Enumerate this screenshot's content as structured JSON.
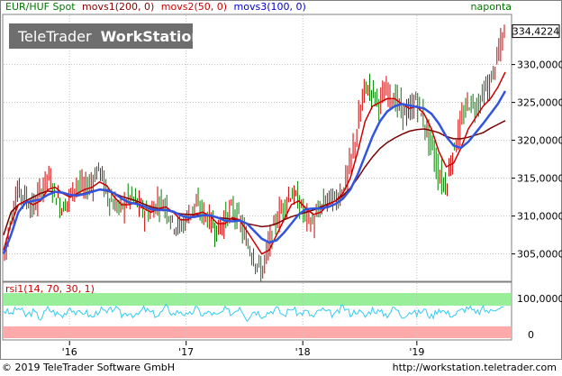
{
  "header": {
    "symbol": "EUR/HUF Spot",
    "indicators": [
      {
        "label": "movs1(200, 0)",
        "color": "#8b0000"
      },
      {
        "label": "movs2(50, 0)",
        "color": "#cc0000"
      },
      {
        "label": "movs3(100, 0)",
        "color": "#0000cc"
      }
    ],
    "source": "naponta"
  },
  "watermark": {
    "brand": "TeleTrader",
    "product": "WorkStation"
  },
  "price_axis": {
    "ticks": [
      "330,0000",
      "325,0000",
      "320,0000",
      "315,0000",
      "310,0000",
      "305,0000"
    ],
    "last_value": "334,4224"
  },
  "rsi_pane": {
    "label": "rsi1(14, 70, 30, 1)",
    "ticks": [
      "100,0000",
      "0"
    ]
  },
  "time_axis": {
    "ticks": [
      "'16",
      "'17",
      "'18",
      "'19"
    ]
  },
  "footer": {
    "copyright": "© 2019 TeleTrader Software GmbH",
    "url": "http://workstation.teletrader.com"
  },
  "colors": {
    "grid": "#bfbfbf",
    "price_up": "#cc0000",
    "price_down": "#008000",
    "ma200": "#7a0000",
    "ma50": "#cc0000",
    "ma100": "#3355dd",
    "rsi_line": "#33ccee",
    "rsi_overbought": "#99ee99",
    "rsi_oversold": "#ffaaaa"
  },
  "chart_data": {
    "type": "line",
    "title": "EUR/HUF Spot",
    "ylim": [
      301.5,
      336.5
    ],
    "yticks": [
      305,
      310,
      315,
      320,
      325,
      330
    ],
    "xticks": [
      "'16",
      "'17",
      "'18",
      "'19"
    ],
    "series": [
      {
        "name": "EUR/HUF Spot",
        "kind": "price",
        "values": [
          304.5,
          309.5,
          313.5,
          312.5,
          311.0,
          313.0,
          315.5,
          313.0,
          311.0,
          312.5,
          314.5,
          313.5,
          314.5,
          316.5,
          313.0,
          311.5,
          311.0,
          312.5,
          312.0,
          310.5,
          310.5,
          312.0,
          311.5,
          309.0,
          308.5,
          310.0,
          311.5,
          310.5,
          309.5,
          308.0,
          309.5,
          311.0,
          309.5,
          306.5,
          304.5,
          302.5,
          306.0,
          309.5,
          311.5,
          313.0,
          312.0,
          310.0,
          309.0,
          311.0,
          312.5,
          312.0,
          313.5,
          316.5,
          321.5,
          327.0,
          326.5,
          325.0,
          326.5,
          325.5,
          324.0,
          323.5,
          325.5,
          322.5,
          319.5,
          315.5,
          314.0,
          318.5,
          322.0,
          325.0,
          324.5,
          326.0,
          327.5,
          331.0,
          334.4
        ]
      },
      {
        "name": "movs1(200, 0)",
        "kind": "ma200",
        "values": [
          307.5,
          310.5,
          311.5,
          312.0,
          312.5,
          313.0,
          313.3,
          313.2,
          313.0,
          312.8,
          312.8,
          313.0,
          313.3,
          313.5,
          313.3,
          313.0,
          312.6,
          312.3,
          312.0,
          311.6,
          311.2,
          311.0,
          310.8,
          310.5,
          310.3,
          310.2,
          310.2,
          310.1,
          310.0,
          309.8,
          309.7,
          309.6,
          309.4,
          309.0,
          308.8,
          308.6,
          308.7,
          309.0,
          309.5,
          309.9,
          310.2,
          310.5,
          310.8,
          311.2,
          311.6,
          312.0,
          312.7,
          313.7,
          315.0,
          316.5,
          317.8,
          318.9,
          319.7,
          320.3,
          320.8,
          321.2,
          321.4,
          321.5,
          321.3,
          321.0,
          320.5,
          320.2,
          320.2,
          320.4,
          320.7,
          321.0,
          321.6,
          322.1,
          322.6
        ]
      },
      {
        "name": "movs2(50, 0)",
        "kind": "ma50",
        "values": [
          305.5,
          309.0,
          311.5,
          312.0,
          311.5,
          312.0,
          313.5,
          313.8,
          313.0,
          312.5,
          313.0,
          313.5,
          313.8,
          314.5,
          314.0,
          312.5,
          311.5,
          311.5,
          311.8,
          311.0,
          310.5,
          311.0,
          311.2,
          310.5,
          309.5,
          309.5,
          310.3,
          310.5,
          310.0,
          309.0,
          309.0,
          309.8,
          309.5,
          308.0,
          306.5,
          305.0,
          305.5,
          307.5,
          309.5,
          311.5,
          312.0,
          311.0,
          310.2,
          310.5,
          311.5,
          312.0,
          313.0,
          315.0,
          318.5,
          322.5,
          324.5,
          325.0,
          325.5,
          325.5,
          324.8,
          324.2,
          324.5,
          323.5,
          321.5,
          318.5,
          316.5,
          317.0,
          319.0,
          321.5,
          323.0,
          324.5,
          325.5,
          327.0,
          329.0
        ]
      },
      {
        "name": "movs3(100, 0)",
        "kind": "ma100",
        "values": [
          305.0,
          307.5,
          310.5,
          311.8,
          312.0,
          312.2,
          312.8,
          313.2,
          313.1,
          312.8,
          312.7,
          312.9,
          313.2,
          313.5,
          313.4,
          313.0,
          312.3,
          311.8,
          311.6,
          311.3,
          310.9,
          310.8,
          310.8,
          310.6,
          310.1,
          309.8,
          309.9,
          310.1,
          310.1,
          309.8,
          309.4,
          309.3,
          309.4,
          309.0,
          308.0,
          307.0,
          306.5,
          306.8,
          307.8,
          309.0,
          310.2,
          310.9,
          311.0,
          311.0,
          311.2,
          311.6,
          312.3,
          313.5,
          315.5,
          318.0,
          320.5,
          322.5,
          323.8,
          324.5,
          324.8,
          324.6,
          324.4,
          324.2,
          323.5,
          322.2,
          320.5,
          319.3,
          319.0,
          319.8,
          321.0,
          322.2,
          323.5,
          324.8,
          326.5
        ]
      }
    ],
    "rsi": {
      "name": "rsi1(14, 70, 30, 1)",
      "ylim": [
        0,
        100
      ],
      "levels": [
        70,
        30
      ],
      "values": [
        55,
        48,
        60,
        45,
        52,
        40,
        58,
        50,
        44,
        62,
        47,
        53,
        41,
        57,
        49,
        60,
        46,
        52,
        43,
        58,
        50,
        45,
        61,
        48,
        54,
        42,
        59,
        47,
        51,
        44,
        56,
        49,
        63,
        40,
        55,
        46,
        52,
        58,
        45,
        60,
        48,
        53,
        42,
        57,
        50,
        46,
        62,
        49,
        55,
        43,
        58,
        51,
        47,
        60,
        44,
        53,
        48,
        56,
        42,
        59,
        50,
        46,
        54,
        61,
        48,
        57,
        52,
        63,
        58
      ]
    }
  }
}
